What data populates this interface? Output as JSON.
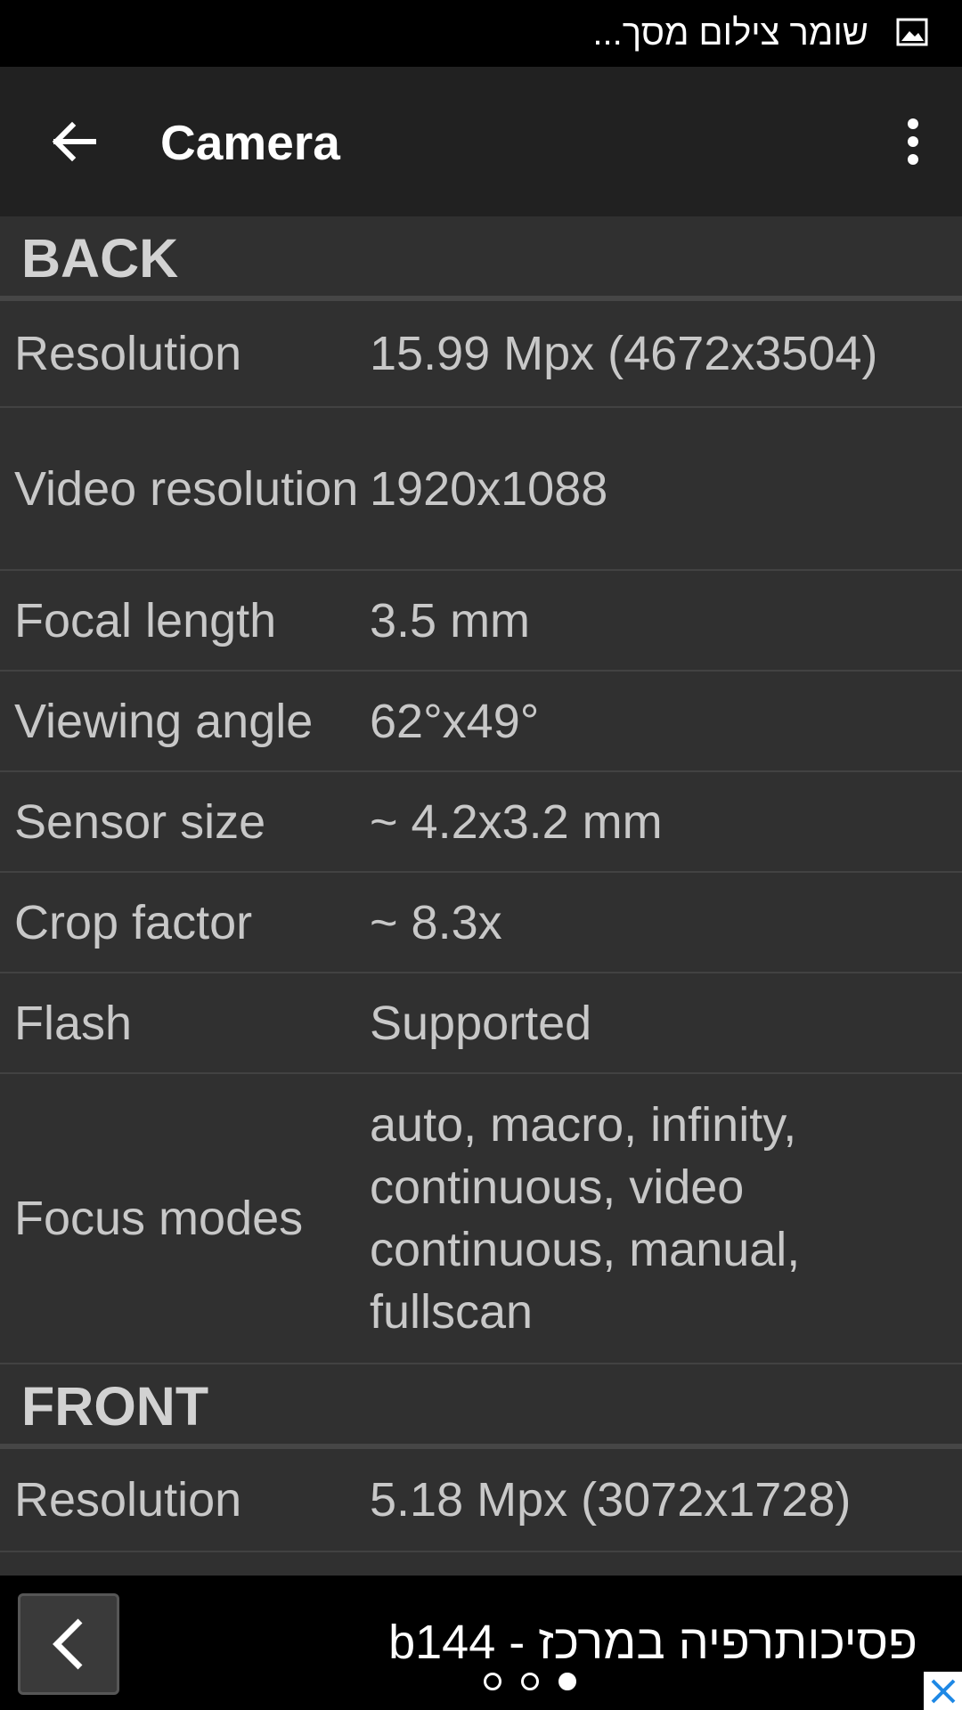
{
  "status_bar": {
    "notification_text": "שומר צילום מסך...",
    "notification_icon": "image-icon"
  },
  "app_bar": {
    "back_icon": "arrow-back-icon",
    "title": "Camera",
    "overflow_icon": "more-vert-icon"
  },
  "sections": [
    {
      "header": "BACK",
      "rows": [
        {
          "label": "Resolution",
          "value": "15.99 Mpx (4672x3504)"
        },
        {
          "label": "Video resolution",
          "value": "1920x1088"
        },
        {
          "label": "Focal length",
          "value": "3.5 mm"
        },
        {
          "label": "Viewing angle",
          "value": "62°x49°"
        },
        {
          "label": "Sensor size",
          "value": "~ 4.2x3.2 mm"
        },
        {
          "label": "Crop factor",
          "value": "~ 8.3x"
        },
        {
          "label": "Flash",
          "value": "Supported"
        },
        {
          "label": "Focus modes",
          "value": "auto, macro, infinity, continuous, video continuous, manual, fullscan"
        }
      ]
    },
    {
      "header": "FRONT",
      "rows": [
        {
          "label": "Resolution",
          "value": "5.18 Mpx (3072x1728)"
        }
      ]
    }
  ],
  "ad_banner": {
    "text": "פסיכותרפיה במרכז - b144",
    "back_icon": "chevron-left-icon",
    "close_icon": "close-icon",
    "page_count": 3,
    "active_page": 3
  },
  "colors": {
    "background": "#303030",
    "app_bar": "#212121",
    "status_bar": "#000000",
    "text": "#c8c8c8",
    "divider": "#424242",
    "close_x": "#1e88e5"
  }
}
